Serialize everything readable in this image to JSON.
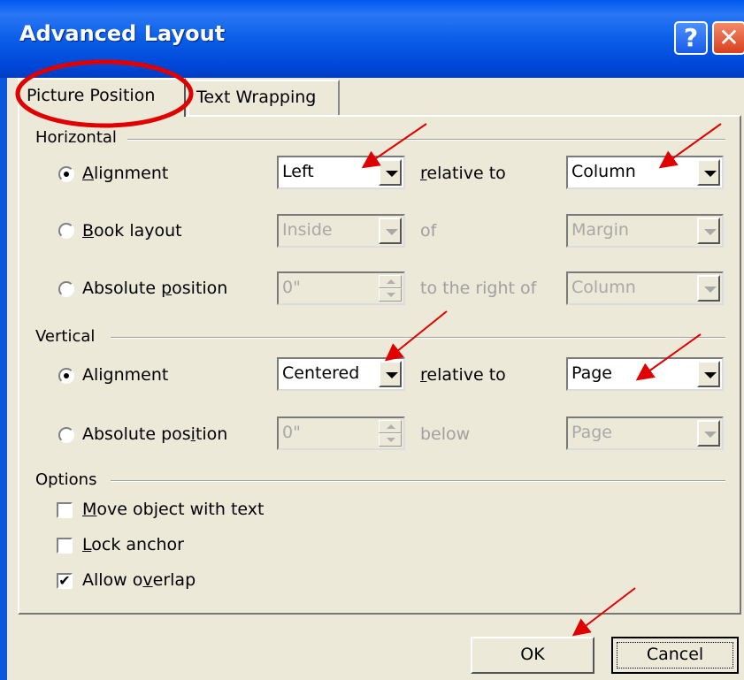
{
  "window": {
    "title": "Advanced Layout",
    "help_glyph": "?",
    "close_glyph": "✕"
  },
  "tabs": [
    {
      "label": "Picture Position",
      "active": true
    },
    {
      "label": "Text Wrapping",
      "active": false
    }
  ],
  "horizontal": {
    "section_label": "Horizontal",
    "alignment": {
      "label_pre": "",
      "label_u": "A",
      "label_post": "lignment",
      "checked": true,
      "value": "Left",
      "relation_pre": "",
      "relation_u": "r",
      "relation_post": "elative to",
      "relative_value": "Column"
    },
    "book_layout": {
      "label_u": "B",
      "label_post": "ook layout",
      "checked": false,
      "value": "Inside",
      "relation": "of",
      "relative_value": "Margin"
    },
    "absolute_position": {
      "label_pre": "Absolute ",
      "label_u": "p",
      "label_post": "osition",
      "checked": false,
      "value": "0\"",
      "relation": "to the right of",
      "relative_value": "Column"
    }
  },
  "vertical": {
    "section_label": "Vertical",
    "alignment": {
      "label": "Alignment",
      "checked": true,
      "value": "Centered",
      "relation_u": "r",
      "relation_post": "elative to",
      "relative_value": "Page"
    },
    "absolute_position": {
      "label_pre": "Absolute pos",
      "label_u": "i",
      "label_post": "tion",
      "checked": false,
      "value": "0\"",
      "relation": "below",
      "relative_value": "Page"
    }
  },
  "options": {
    "section_label": "Options",
    "move_with_text": {
      "label_u": "M",
      "label_post": "ove object with text",
      "checked": false
    },
    "lock_anchor": {
      "label_u": "L",
      "label_post": "ock anchor",
      "checked": false
    },
    "allow_overlap": {
      "label_pre": "Allow o",
      "label_u": "v",
      "label_post": "erlap",
      "checked": true,
      "check_glyph": "✔"
    }
  },
  "buttons": {
    "ok": "OK",
    "cancel": "Cancel"
  },
  "colors": {
    "titlebar": "#0058ee",
    "dialog_bg": "#ece9d8",
    "annotation": "#e00000"
  }
}
